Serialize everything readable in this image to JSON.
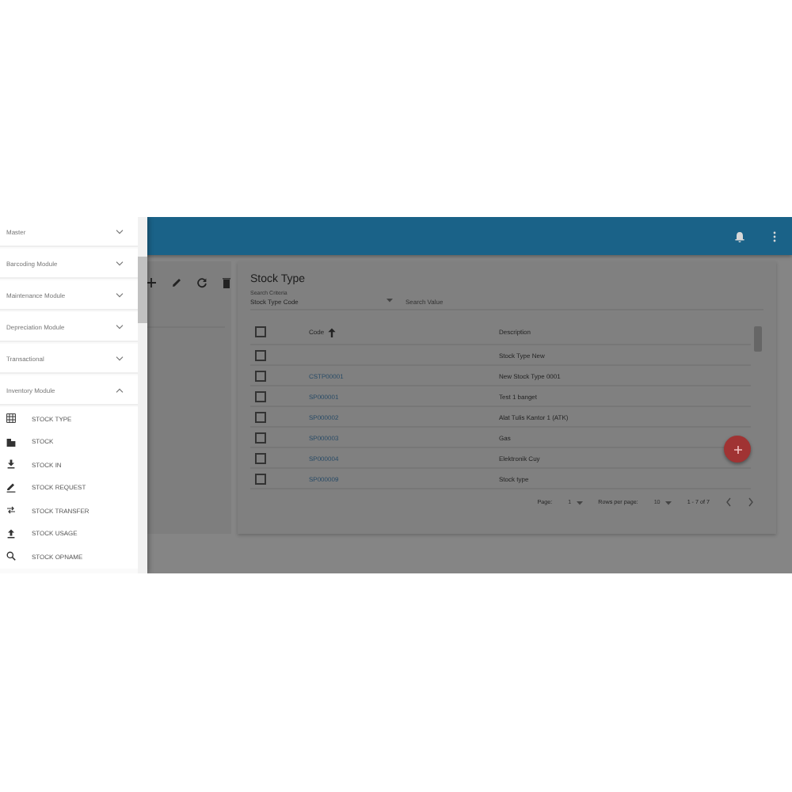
{
  "drawer": {
    "modules": [
      {
        "label": "Master",
        "expanded": false
      },
      {
        "label": "Barcoding Module",
        "expanded": false
      },
      {
        "label": "Maintenance Module",
        "expanded": false
      },
      {
        "label": "Depreciation Module",
        "expanded": false
      },
      {
        "label": "Transactional",
        "expanded": false
      },
      {
        "label": "Inventory Module",
        "expanded": true,
        "children": [
          {
            "label": "STOCK TYPE",
            "kind": "grid"
          },
          {
            "label": "STOCK",
            "kind": "building"
          },
          {
            "label": "STOCK IN",
            "kind": "download"
          },
          {
            "label": "STOCK REQUEST",
            "kind": "pencil"
          },
          {
            "label": "STOCK TRANSFER",
            "kind": "swap"
          },
          {
            "label": "STOCK USAGE",
            "kind": "upload"
          },
          {
            "label": "STOCK OPNAME",
            "kind": "search"
          }
        ]
      }
    ]
  },
  "card": {
    "title": "Stock Type",
    "search_label": "Search Criteria",
    "criteria": "Stock Type Code",
    "search": {
      "placeholder": "Search Value"
    }
  },
  "table": {
    "columns": [
      "Code",
      "Description"
    ],
    "select_all_checked": false,
    "rows": [
      {
        "code": "",
        "description": "Stock Type New",
        "checked": false
      },
      {
        "code": "CSTP00001",
        "description": "New Stock Type 0001",
        "checked": false
      },
      {
        "code": "SP000001",
        "description": "Test 1 banget",
        "checked": false
      },
      {
        "code": "SP000002",
        "description": "Alat Tulis Kantor 1 (ATK)",
        "checked": false
      },
      {
        "code": "SP000003",
        "description": "Gas",
        "checked": false
      },
      {
        "code": "SP000004",
        "description": "Elektronik Cuy",
        "checked": false
      },
      {
        "code": "SP000009",
        "description": "Stock type",
        "checked": false
      }
    ]
  },
  "pagination": {
    "page_label": "Page:",
    "page": "1",
    "rows_label": "Rows per page:",
    "rows": "10",
    "range": "1 - 7 of 7"
  }
}
